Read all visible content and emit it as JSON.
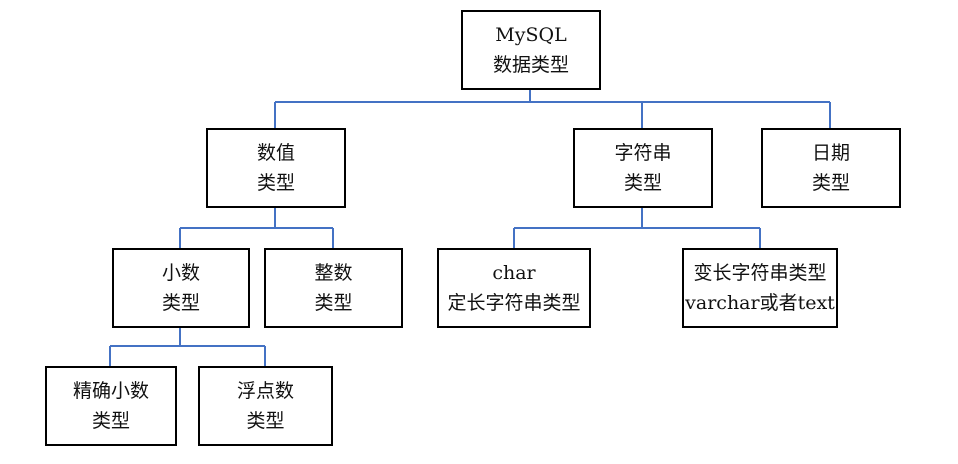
{
  "diagram": {
    "connector_color": "#4472C4",
    "nodes": {
      "root": [
        "MySQL",
        "数据类型"
      ],
      "numeric": [
        "数值",
        "类型"
      ],
      "string": [
        "字符串",
        "类型"
      ],
      "date": [
        "日期",
        "类型"
      ],
      "decimal": [
        "小数",
        "类型"
      ],
      "integer": [
        "整数",
        "类型"
      ],
      "char": [
        "char",
        "定长字符串类型"
      ],
      "varchar": [
        "变长字符串类型",
        "varchar或者text"
      ],
      "exact_decimal": [
        "精确小数",
        "类型"
      ],
      "float": [
        "浮点数",
        "类型"
      ]
    }
  }
}
